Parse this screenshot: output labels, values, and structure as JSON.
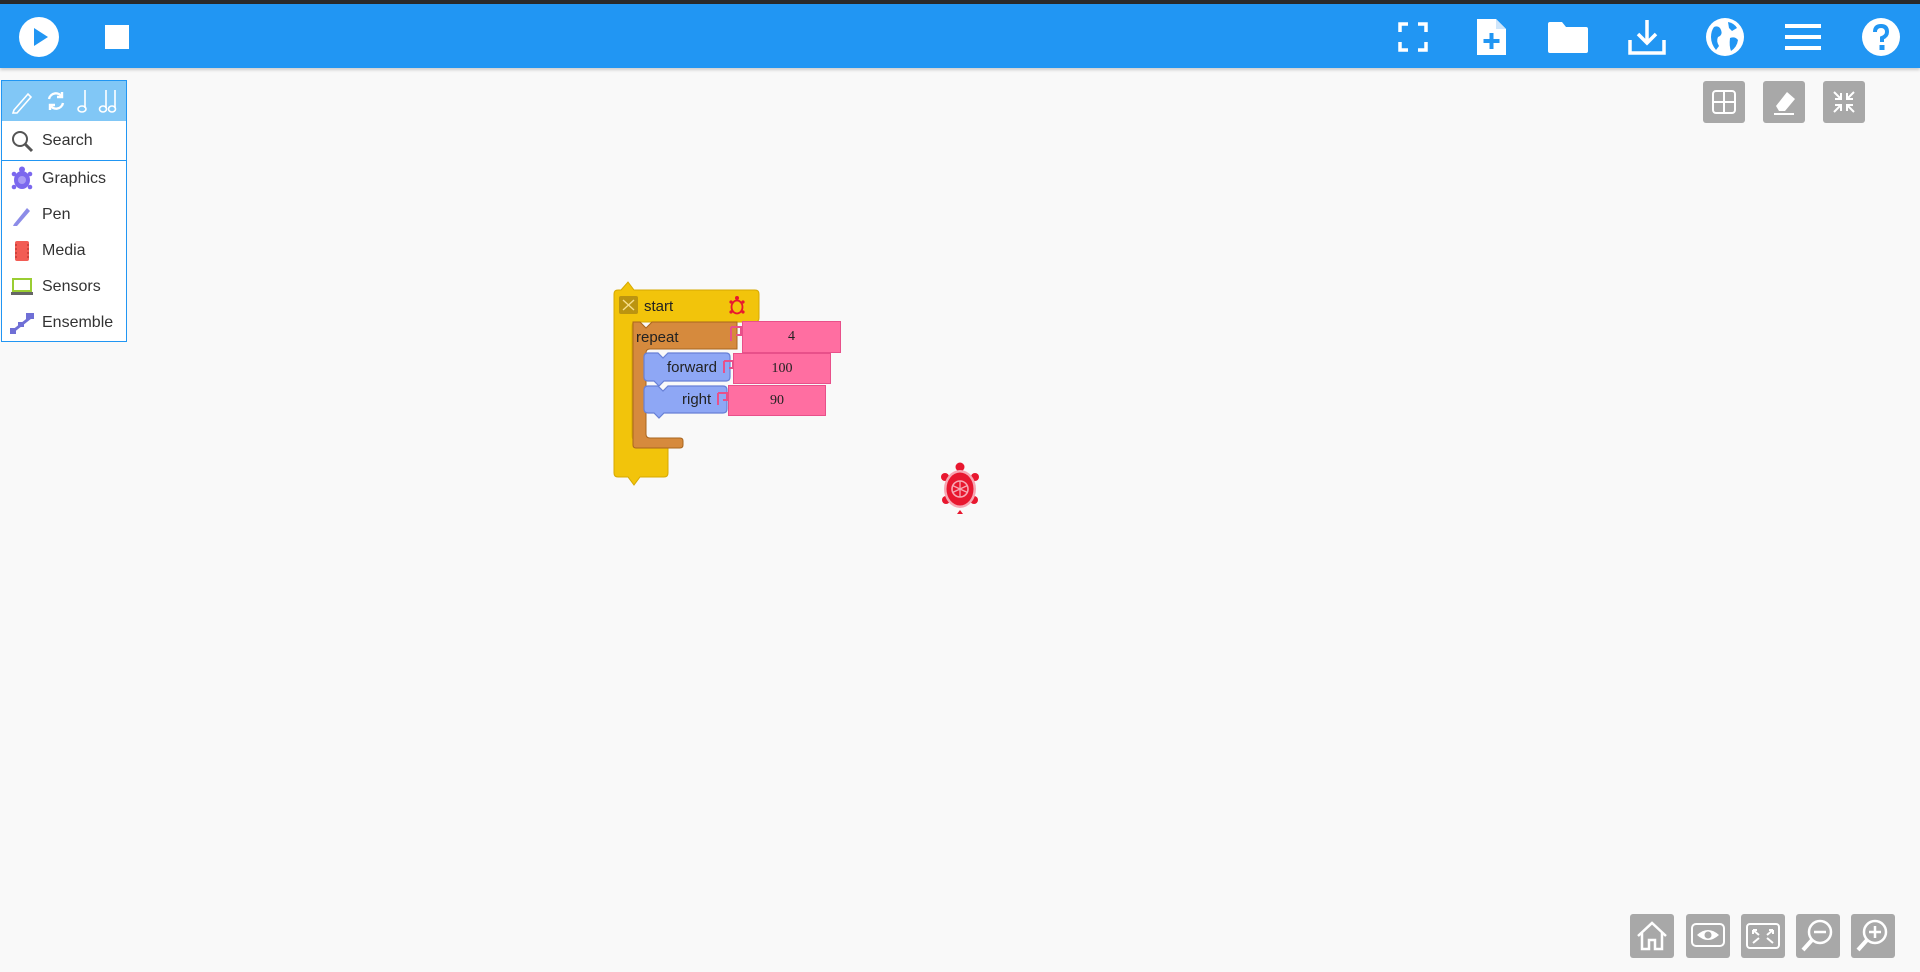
{
  "toolbar": {
    "left": [
      {
        "name": "play-icon"
      },
      {
        "name": "stop-icon"
      }
    ],
    "right": [
      {
        "name": "fullscreen-icon"
      },
      {
        "name": "new-file-icon"
      },
      {
        "name": "open-folder-icon"
      },
      {
        "name": "save-download-icon"
      },
      {
        "name": "language-globe-icon"
      },
      {
        "name": "menu-icon"
      },
      {
        "name": "help-icon"
      }
    ],
    "color": "#2196f3"
  },
  "palette": {
    "header_icons": [
      "pen-icon",
      "refresh-icon",
      "note-icon",
      "double-note-icon"
    ],
    "search_label": "Search",
    "items": [
      {
        "label": "Graphics",
        "icon": "turtle-icon",
        "color": "#7b68ee"
      },
      {
        "label": "Pen",
        "icon": "pen-icon",
        "color": "#8c8ce8"
      },
      {
        "label": "Media",
        "icon": "media-icon",
        "color": "#f25c54"
      },
      {
        "label": "Sensors",
        "icon": "sensors-icon",
        "color": "#9acd32"
      },
      {
        "label": "Ensemble",
        "icon": "ensemble-icon",
        "color": "#6f6fd6"
      }
    ]
  },
  "canvas_controls": [
    "grid-icon",
    "eraser-icon",
    "collapse-icon"
  ],
  "bottom_controls": [
    "home-icon",
    "eye-icon",
    "expand-icon",
    "zoom-out-icon",
    "zoom-in-icon"
  ],
  "blocks": {
    "start": {
      "label": "start",
      "color": "#f2c40b"
    },
    "repeat": {
      "label": "repeat",
      "arg": "4",
      "color": "#d68a3d"
    },
    "forward": {
      "label": "forward",
      "arg": "100",
      "color": "#8ea7f5"
    },
    "right": {
      "label": "right",
      "arg": "90",
      "color": "#8ea7f5"
    }
  },
  "turtle": {
    "icon": "turtle-sprite-icon",
    "color": "#e8172f"
  }
}
